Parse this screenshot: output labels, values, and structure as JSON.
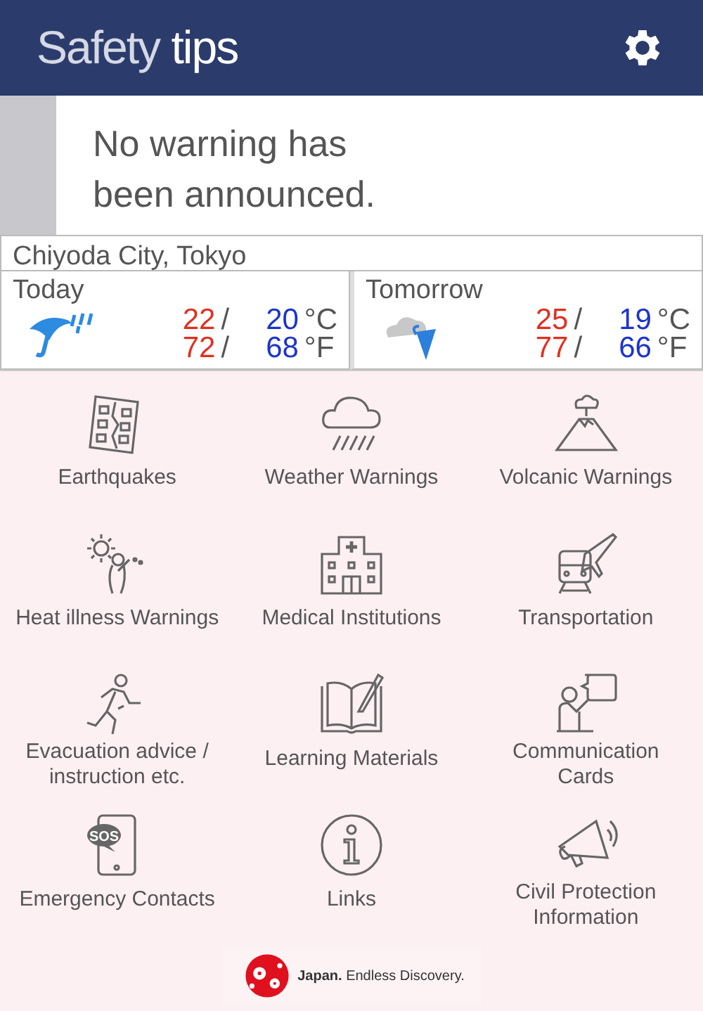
{
  "header": {
    "title_light": "Safety",
    "title_strong": "tips"
  },
  "warning": {
    "text": "No warning has\nbeen announced."
  },
  "location": "Chiyoda City, Tokyo",
  "forecast": [
    {
      "day": "Today",
      "kind": "rain",
      "rows": [
        {
          "high": "22",
          "separator": "/",
          "low": "20",
          "unit": "°C"
        },
        {
          "high": "72",
          "separator": "/",
          "low": "68",
          "unit": "°F"
        }
      ]
    },
    {
      "day": "Tomorrow",
      "kind": "cloudrain",
      "rows": [
        {
          "high": "25",
          "separator": "/",
          "low": "19",
          "unit": "°C"
        },
        {
          "high": "77",
          "separator": "/",
          "low": "66",
          "unit": "°F"
        }
      ]
    }
  ],
  "menu": [
    {
      "label": "Earthquakes",
      "kind": "quake"
    },
    {
      "label": "Weather Warnings",
      "kind": "rain"
    },
    {
      "label": "Volcanic Warnings",
      "kind": "volcano"
    },
    {
      "label": "Heat illness Warnings",
      "kind": "heat"
    },
    {
      "label": "Medical Institutions",
      "kind": "hospital"
    },
    {
      "label": "Transportation",
      "kind": "transport"
    },
    {
      "label": "Evacuation advice /\ninstruction etc.",
      "kind": "run"
    },
    {
      "label": "Learning Materials",
      "kind": "book"
    },
    {
      "label": "Communication\nCards",
      "kind": "speech"
    },
    {
      "label": "Emergency Contacts",
      "kind": "sos",
      "icon_text": "SOS"
    },
    {
      "label": "Links",
      "kind": "info"
    },
    {
      "label": "Civil Protection\nInformation",
      "kind": "megaphone"
    }
  ],
  "footer_logo": {
    "text": "**Japan.** Endless Discovery."
  }
}
